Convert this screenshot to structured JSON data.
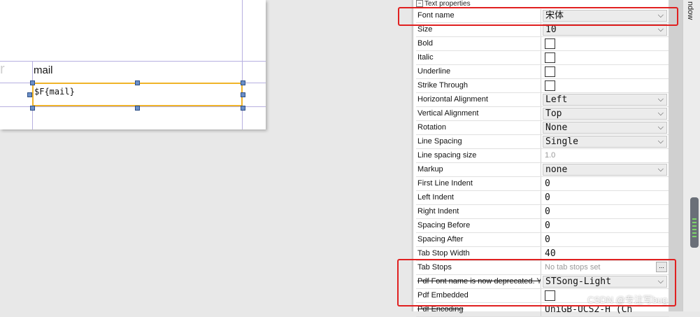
{
  "canvas": {
    "partial_column_letter": "r",
    "field_label": "mail",
    "field_expression": "$F{mail}"
  },
  "panel": {
    "section_title": "Text properties",
    "rows": [
      {
        "name": "Font name",
        "type": "combo",
        "value": "宋体"
      },
      {
        "name": "Size",
        "type": "combo",
        "value": "10"
      },
      {
        "name": "Bold",
        "type": "checkbox",
        "checked": false
      },
      {
        "name": "Italic",
        "type": "checkbox",
        "checked": false
      },
      {
        "name": "Underline",
        "type": "checkbox",
        "checked": false
      },
      {
        "name": "Strike Through",
        "type": "checkbox",
        "checked": false
      },
      {
        "name": "Horizontal Alignment",
        "type": "combo",
        "value": "Left"
      },
      {
        "name": "Vertical Alignment",
        "type": "combo",
        "value": "Top"
      },
      {
        "name": "Rotation",
        "type": "combo",
        "value": "None"
      },
      {
        "name": "Line Spacing",
        "type": "combo",
        "value": "Single"
      },
      {
        "name": "Line spacing size",
        "type": "text",
        "value": "1.0",
        "muted": true
      },
      {
        "name": "Markup",
        "type": "combo",
        "value": "none"
      },
      {
        "name": "First Line Indent",
        "type": "text",
        "value": "0"
      },
      {
        "name": "Left Indent",
        "type": "text",
        "value": "0"
      },
      {
        "name": "Right Indent",
        "type": "text",
        "value": "0"
      },
      {
        "name": "Spacing Before",
        "type": "text",
        "value": "0"
      },
      {
        "name": "Spacing After",
        "type": "text",
        "value": "0"
      },
      {
        "name": "Tab Stop Width",
        "type": "text",
        "value": "40"
      },
      {
        "name": "Tab Stops",
        "type": "button",
        "value": "No tab stops set",
        "muted": true,
        "button_label": "..."
      },
      {
        "name": "Pdf Font name is now deprecated. Y",
        "type": "combo",
        "value": "STSong-Light",
        "strike": true
      },
      {
        "name": "Pdf Embedded",
        "type": "checkbox",
        "checked": false
      },
      {
        "name": "Pdf Encoding",
        "type": "text",
        "value": "UniGB-UCS2-H (Ch",
        "strike": true
      }
    ]
  },
  "side_strip": {
    "label": "ndow"
  },
  "watermark": "CSDN @专注写bug",
  "colors": {
    "highlight": "#e02020",
    "selection_border": "#f0b429",
    "handle": "#6b8fc7"
  }
}
